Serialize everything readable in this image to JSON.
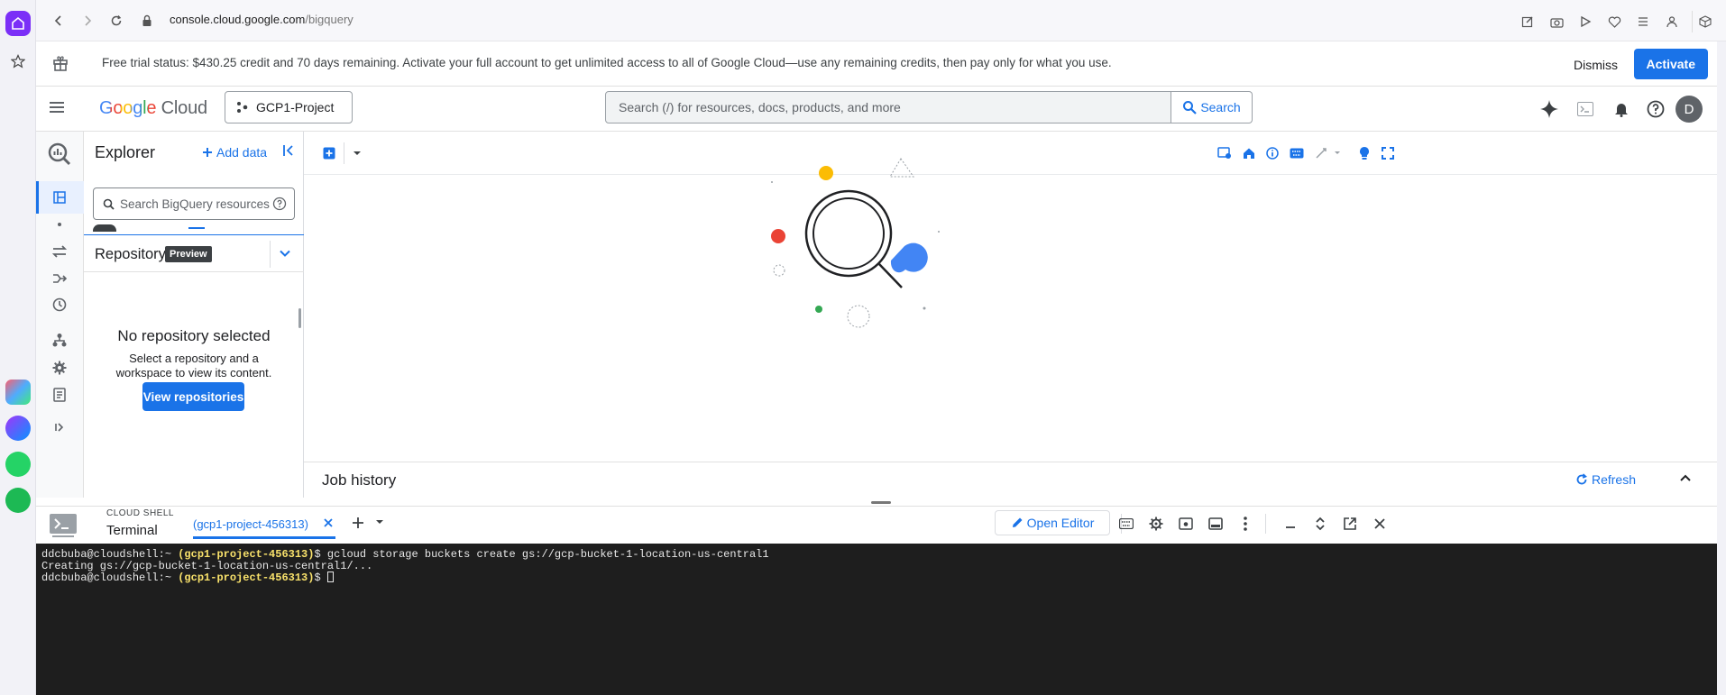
{
  "browser": {
    "url_host": "console.cloud.google.com",
    "url_path": "/bigquery"
  },
  "banner": {
    "text": "Free trial status: $430.25 credit and 70 days remaining. Activate your full account to get unlimited access to all of Google Cloud—use any remaining credits, then pay only for what you use.",
    "dismiss_label": "Dismiss",
    "activate_label": "Activate"
  },
  "header": {
    "logo_google": "Google",
    "logo_cloud": "Cloud",
    "project_name": "GCP1-Project",
    "search_placeholder": "Search (/) for resources, docs, products, and more",
    "search_button": "Search",
    "avatar_initial": "D"
  },
  "explorer": {
    "title": "Explorer",
    "add_data": "Add data",
    "search_placeholder": "Search BigQuery resources"
  },
  "repository": {
    "title": "Repository",
    "badge": "Preview",
    "empty_title": "No repository selected",
    "empty_desc": "Select a repository and a workspace to view its content.",
    "view_button": "View repositories"
  },
  "job_history": {
    "title": "Job history",
    "refresh_label": "Refresh"
  },
  "cloud_shell": {
    "caption": "CLOUD SHELL",
    "terminal_label": "Terminal",
    "tab_label": "(gcp1-project-456313)",
    "open_editor": "Open Editor"
  },
  "terminal": {
    "prompt_user": "ddcbuba@cloudshell:~ ",
    "prompt_project": "(gcp1-project-456313)",
    "prompt_suffix": "$ ",
    "command_1": "gcloud storage buckets create gs://gcp-bucket-1-location-us-central1",
    "output_1": "Creating gs://gcp-bucket-1-location-us-central1/..."
  },
  "colors": {
    "accent": "#1a73e8",
    "terminal_bg": "#1e1e1e",
    "prompt_project": "#f9e26b"
  }
}
